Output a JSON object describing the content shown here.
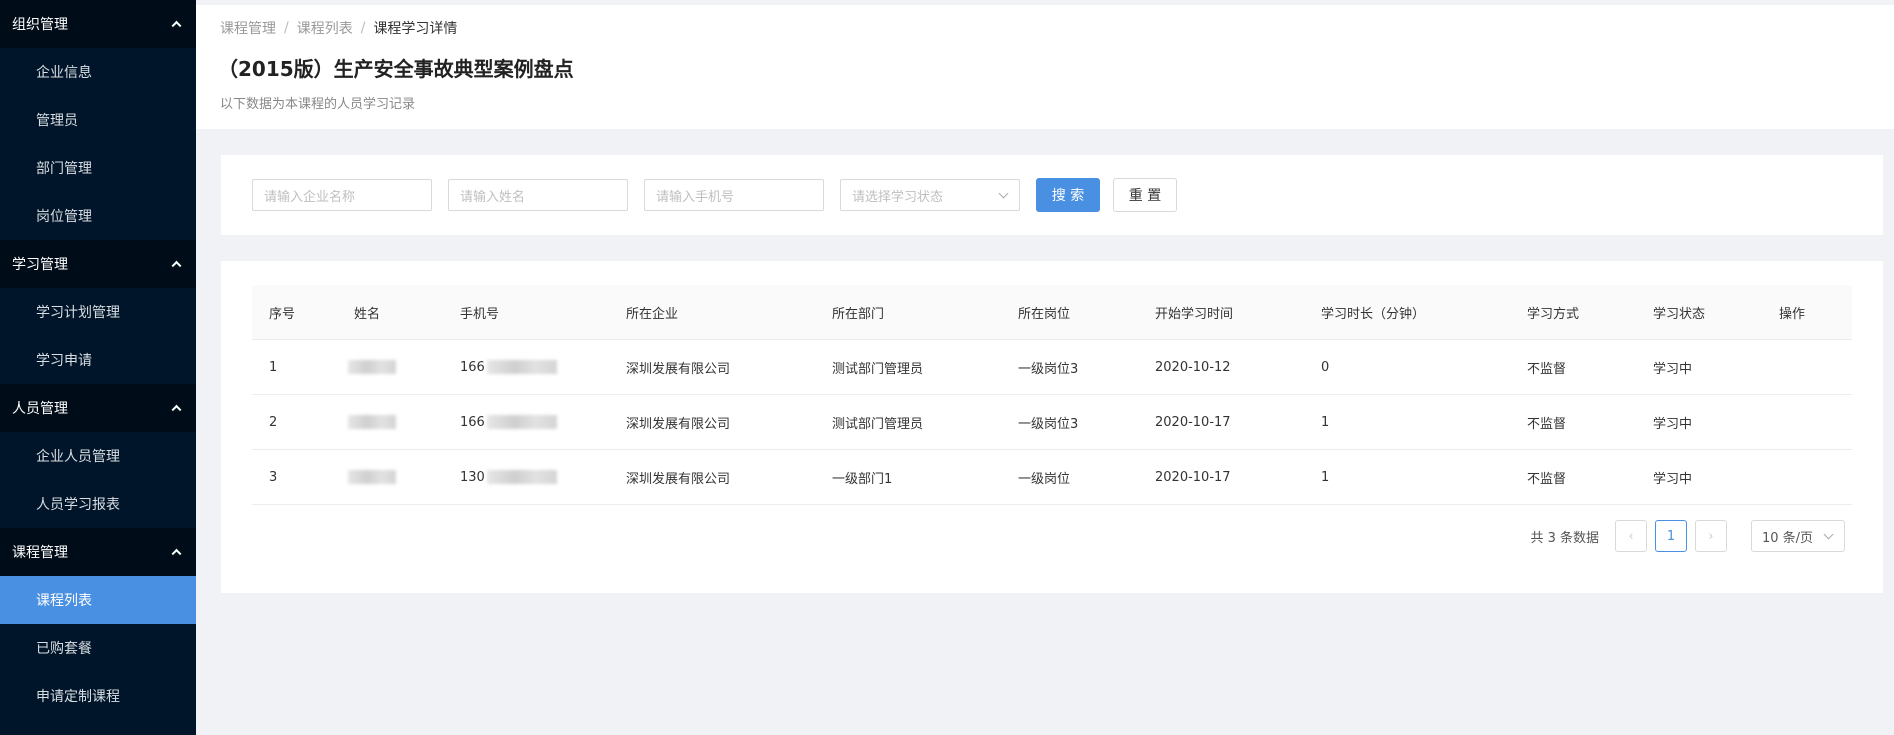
{
  "sidebar": {
    "groups": [
      {
        "title": "组织管理",
        "items": [
          "企业信息",
          "管理员",
          "部门管理",
          "岗位管理"
        ]
      },
      {
        "title": "学习管理",
        "items": [
          "学习计划管理",
          "学习申请"
        ]
      },
      {
        "title": "人员管理",
        "items": [
          "企业人员管理",
          "人员学习报表"
        ]
      },
      {
        "title": "课程管理",
        "items": [
          "课程列表",
          "已购套餐",
          "申请定制课程"
        ]
      }
    ],
    "active_item": "课程列表"
  },
  "breadcrumb": [
    "课程管理",
    "课程列表",
    "课程学习详情"
  ],
  "breadcrumb_sep": "/",
  "page": {
    "title": "（2015版）生产安全事故典型案例盘点",
    "description": "以下数据为本课程的人员学习记录"
  },
  "search": {
    "company_placeholder": "请输入企业名称",
    "name_placeholder": "请输入姓名",
    "phone_placeholder": "请输入手机号",
    "status_placeholder": "请选择学习状态",
    "search_label": "搜 索",
    "reset_label": "重 置"
  },
  "table": {
    "headers": [
      "序号",
      "姓名",
      "手机号",
      "所在企业",
      "所在部门",
      "所在岗位",
      "开始学习时间",
      "学习时长（分钟）",
      "学习方式",
      "学习状态",
      "操作"
    ],
    "rows": [
      {
        "index": "1",
        "phone_prefix": "166",
        "company": "深圳发展有限公司",
        "department": "测试部门管理员",
        "position": "一级岗位3",
        "start": "2020-10-12",
        "duration": "0",
        "mode": "不监督",
        "status": "学习中"
      },
      {
        "index": "2",
        "phone_prefix": "166",
        "company": "深圳发展有限公司",
        "department": "测试部门管理员",
        "position": "一级岗位3",
        "start": "2020-10-17",
        "duration": "1",
        "mode": "不监督",
        "status": "学习中"
      },
      {
        "index": "3",
        "phone_prefix": "130",
        "company": "深圳发展有限公司",
        "department": "一级部门1",
        "position": "一级岗位",
        "start": "2020-10-17",
        "duration": "1",
        "mode": "不监督",
        "status": "学习中"
      }
    ]
  },
  "pagination": {
    "total": "共 3 条数据",
    "prev": "‹",
    "current": "1",
    "next": "›",
    "page_size": "10 条/页"
  },
  "colors": {
    "sidebar_bg": "#001529",
    "sidebar_group_bg": "#000c17",
    "accent": "#4a90e2"
  }
}
